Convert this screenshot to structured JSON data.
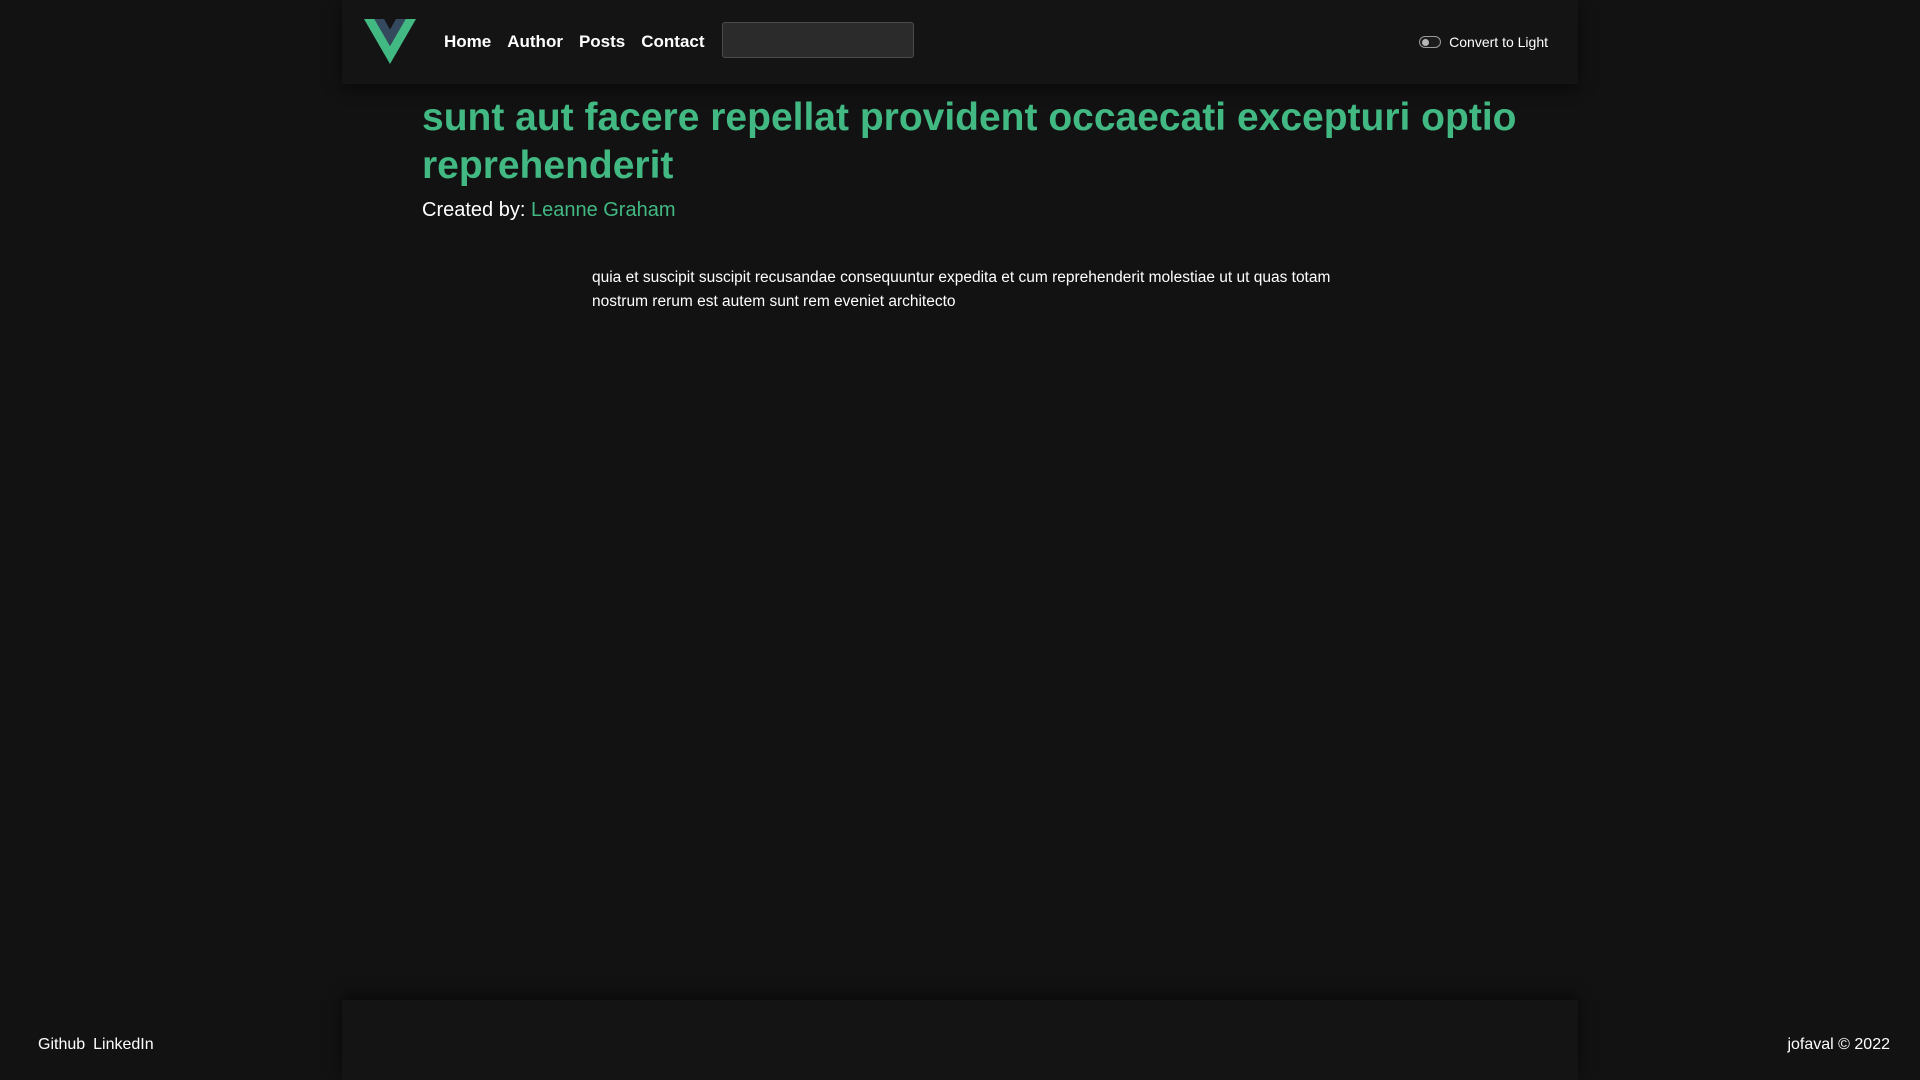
{
  "header": {
    "logo_icon": "vue-logo-icon",
    "nav": {
      "home": "Home",
      "author": "Author",
      "posts": "Posts",
      "contact": "Contact"
    },
    "search": {
      "value": "",
      "placeholder": ""
    },
    "theme_toggle": {
      "label": "Convert to Light"
    }
  },
  "post": {
    "title": "sunt aut facere repellat provident occaecati excepturi optio reprehenderit",
    "created_by_label": "Created by:",
    "author_name": "Leanne Graham",
    "body": "quia et suscipit suscipit recusandae consequuntur expedita et cum reprehenderit molestiae ut ut quas totam nostrum rerum est autem sunt rem eveniet architecto"
  },
  "footer": {
    "links": {
      "github": "Github",
      "linkedin": "LinkedIn"
    },
    "copyright": "jofaval © 2022"
  },
  "colors": {
    "background": "#121212",
    "accent": "#42b883",
    "logo_dark": "#35495e",
    "text": "#ffffff"
  }
}
